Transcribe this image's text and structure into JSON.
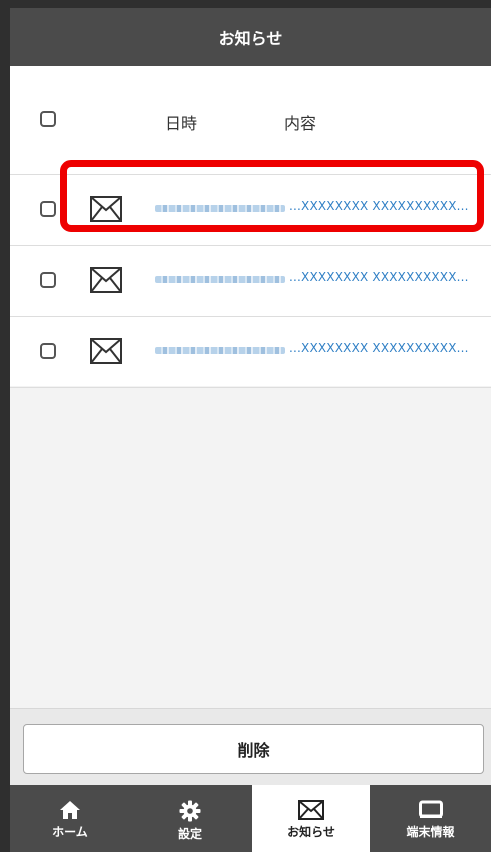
{
  "header": {
    "title": "お知らせ"
  },
  "list": {
    "columns": {
      "date": "日時",
      "content": "内容"
    },
    "items": [
      {
        "message": "...XXXXXXXX XXXXXXXXXX..."
      },
      {
        "message": "...XXXXXXXX XXXXXXXXXX..."
      },
      {
        "message": "...XXXXXXXX XXXXXXXXXX..."
      }
    ]
  },
  "actions": {
    "delete_label": "削除"
  },
  "tabs": [
    {
      "label": "ホーム",
      "icon": "home-icon"
    },
    {
      "label": "設定",
      "icon": "gear-icon"
    },
    {
      "label": "お知らせ",
      "icon": "mail-icon",
      "active": true
    },
    {
      "label": "端末情報",
      "icon": "device-icon"
    }
  ],
  "colors": {
    "header_bg": "#4b4b4b",
    "link": "#2f7fc5",
    "highlight": "#ee0000"
  }
}
